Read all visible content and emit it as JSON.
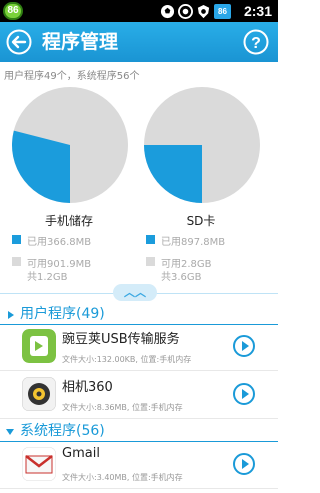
{
  "status_bar": {
    "badge": "86",
    "battery": "86",
    "time": "2:31",
    "icons": [
      "soccer-ball-icon",
      "aperture-icon",
      "shield-icon",
      "battery-icon"
    ]
  },
  "header": {
    "title": "程序管理",
    "back_icon": "back-arrow-icon",
    "help_icon": "question-icon"
  },
  "summary": "用户程序49个，系统程序56个",
  "storage": {
    "phone": {
      "label": "手机储存",
      "used_label": "已用366.8MB",
      "free_label": "可用901.9MB",
      "total_label": "共1.2GB",
      "used_fraction": 0.29
    },
    "sd": {
      "label": "SD卡",
      "used_label": "已用897.8MB",
      "free_label": "可用2.8GB",
      "total_label": "共3.6GB",
      "used_fraction": 0.25
    },
    "colors": {
      "used": "#1b9cdc",
      "free": "#dadada"
    }
  },
  "handle_icon": "double-chevron-up-icon",
  "sections": {
    "user": {
      "title": "用户程序(49)"
    },
    "system": {
      "title": "系统程序(56)"
    }
  },
  "apps": [
    {
      "name": "豌豆荚USB传输服务",
      "meta": "文件大小:132.00KB, 位置:手机内存",
      "icon": "wandoujia-icon"
    },
    {
      "name": "相机360",
      "meta": "文件大小:8.36MB, 位置:手机内存",
      "icon": "camera360-icon"
    },
    {
      "name": "Gmail",
      "meta": "文件大小:3.40MB, 位置:手机内存",
      "icon": "gmail-icon"
    }
  ]
}
